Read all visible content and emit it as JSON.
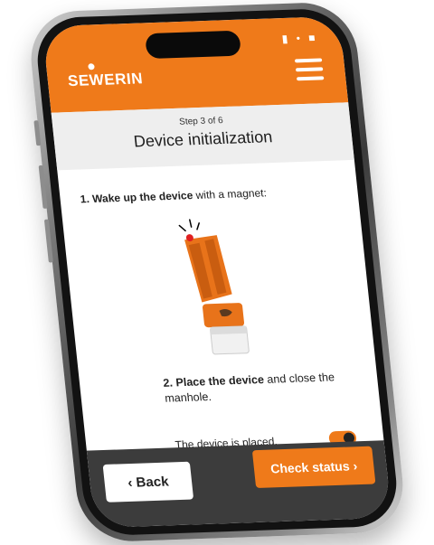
{
  "header": {
    "logo_text": "SEWERIN",
    "menu_icon": "hamburger-menu-icon",
    "status_icons": "▮ • ■"
  },
  "step": {
    "counter": "Step 3 of 6",
    "title": "Device initialization"
  },
  "instructions": {
    "step1_bold": "1. Wake up the device",
    "step1_rest": " with a magnet:",
    "step2_bold": "2. Place the device",
    "step2_rest": " and close the manhole."
  },
  "toggle": {
    "label": "The device is placed.",
    "state": true
  },
  "footer": {
    "back_chevron": "‹",
    "back_label": "Back",
    "check_label": "Check status",
    "check_chevron": "›"
  },
  "colors": {
    "brand_orange": "#ef7a1a",
    "footer_dark": "#3c3c3c",
    "step_bg": "#eeeeee"
  }
}
